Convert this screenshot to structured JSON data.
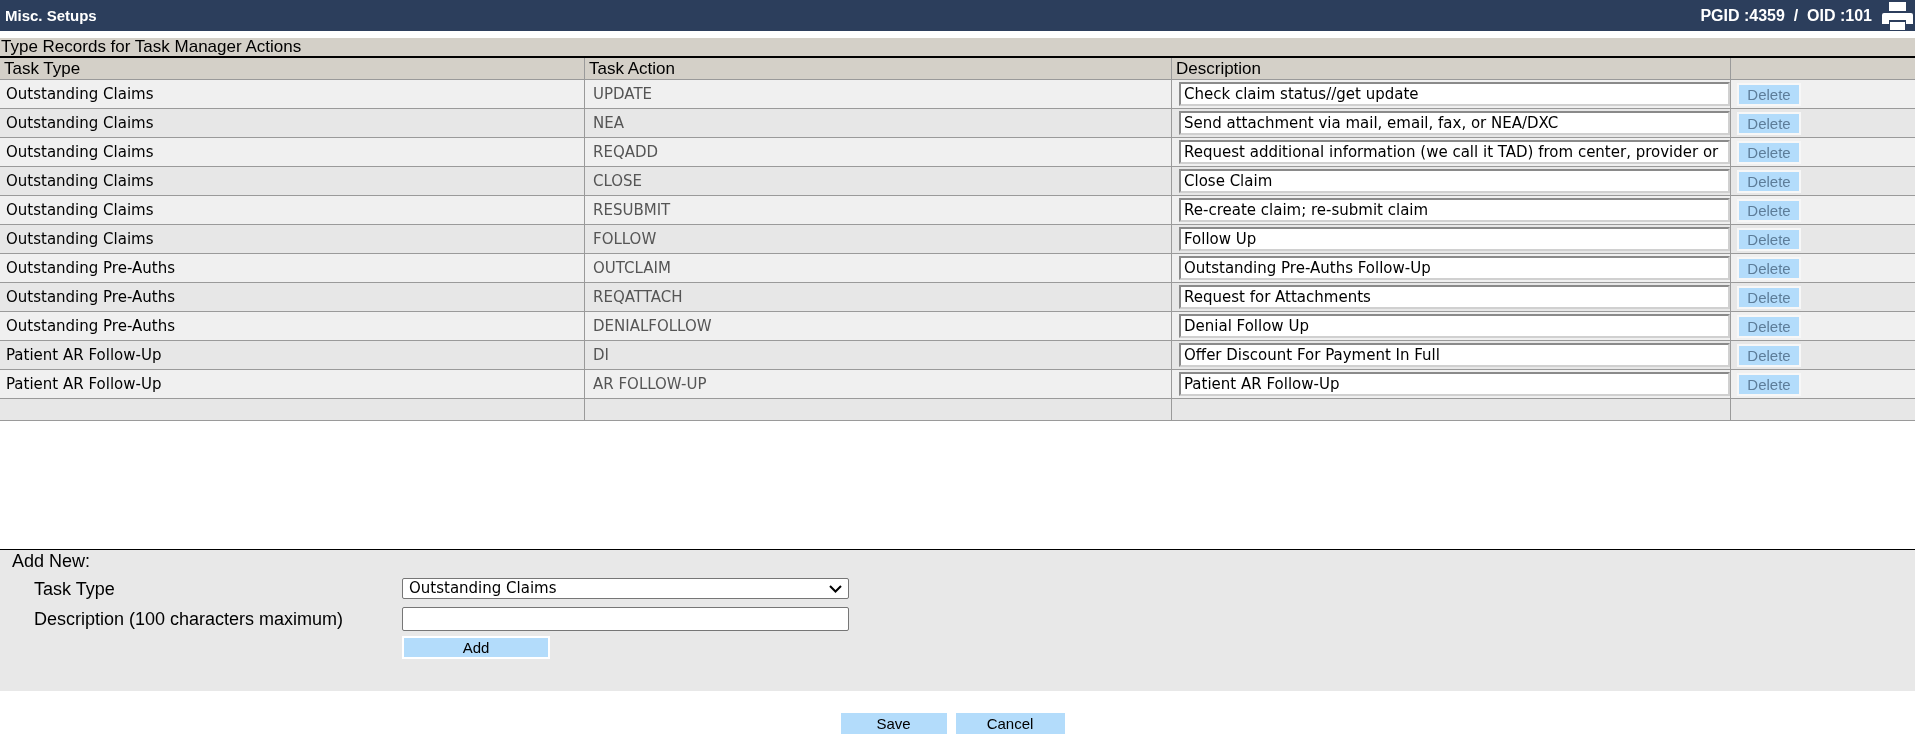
{
  "header": {
    "title": "Misc. Setups",
    "ids": "PGID :4359  /  OID :101"
  },
  "table": {
    "caption": "Type Records for Task Manager Actions",
    "columns": [
      "Task Type",
      "Task Action",
      "Description"
    ],
    "rows": [
      {
        "task_type": "Outstanding Claims",
        "task_action": "UPDATE",
        "description": "Check claim status//get update",
        "delete_label": "Delete",
        "delete_disabled": true
      },
      {
        "task_type": "Outstanding Claims",
        "task_action": "NEA",
        "description": "Send attachment via mail, email, fax, or NEA/DXC",
        "delete_label": "Delete",
        "delete_disabled": true
      },
      {
        "task_type": "Outstanding Claims",
        "task_action": "REQADD",
        "description": "Request additional information (we call it TAD) from center, provider or",
        "delete_label": "Delete",
        "delete_disabled": true
      },
      {
        "task_type": "Outstanding Claims",
        "task_action": "CLOSE",
        "description": "Close Claim",
        "delete_label": "Delete",
        "delete_disabled": true
      },
      {
        "task_type": "Outstanding Claims",
        "task_action": "RESUBMIT",
        "description": "Re-create claim; re-submit claim",
        "delete_label": "Delete",
        "delete_disabled": true
      },
      {
        "task_type": "Outstanding Claims",
        "task_action": "FOLLOW",
        "description": "Follow Up",
        "delete_label": "Delete",
        "delete_disabled": true
      },
      {
        "task_type": "Outstanding Pre-Auths",
        "task_action": "OUTCLAIM",
        "description": "Outstanding Pre-Auths Follow-Up",
        "delete_label": "Delete",
        "delete_disabled": true
      },
      {
        "task_type": "Outstanding Pre-Auths",
        "task_action": "REQATTACH",
        "description": "Request for Attachments",
        "delete_label": "Delete",
        "delete_disabled": true
      },
      {
        "task_type": "Outstanding Pre-Auths",
        "task_action": "DENIALFOLLOW",
        "description": "Denial Follow Up",
        "delete_label": "Delete",
        "delete_disabled": true
      },
      {
        "task_type": "Patient AR Follow-Up",
        "task_action": "DI",
        "description": "Offer Discount For Payment In Full",
        "delete_label": "Delete",
        "delete_disabled": true
      },
      {
        "task_type": "Patient AR Follow-Up",
        "task_action": "AR FOLLOW-UP",
        "description": "Patient AR Follow-Up",
        "delete_label": "Delete",
        "delete_disabled": true
      }
    ]
  },
  "add_new": {
    "title": "Add New:",
    "task_type": {
      "label": "Task Type",
      "value": "Outstanding Claims"
    },
    "description": {
      "label": "Description (100 characters maximum)"
    },
    "add_button": "Add"
  },
  "footer_buttons": [
    "Save",
    "Cancel"
  ]
}
